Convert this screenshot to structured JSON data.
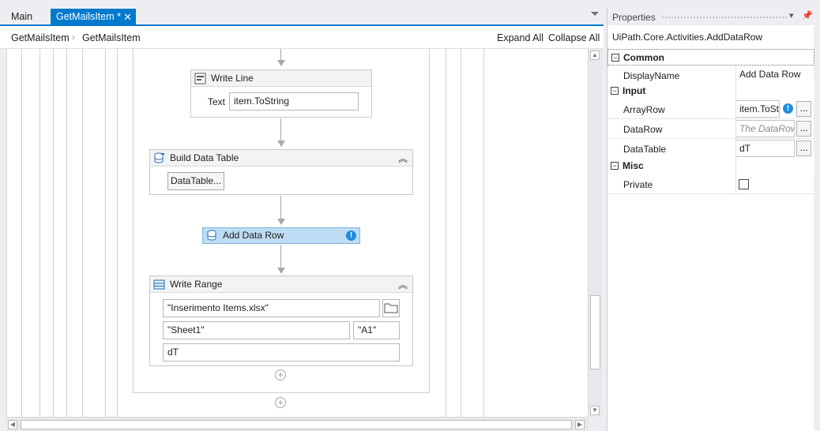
{
  "tabs": {
    "main_label": "Main",
    "active_label": "GetMailsItem *",
    "close_glyph": "✕"
  },
  "breadcrumb": {
    "items": [
      "GetMailsItem",
      "GetMailsItem"
    ],
    "expand_all": "Expand All",
    "collapse_all": "Collapse All"
  },
  "workflow": {
    "write_line": {
      "title": "Write Line",
      "text_label": "Text",
      "text_value": "item.ToString"
    },
    "build_data_table": {
      "title": "Build Data Table",
      "button_label": "DataTable..."
    },
    "add_data_row": {
      "title": "Add Data Row"
    },
    "write_range": {
      "title": "Write Range",
      "workbook": "\"Inserimento Items.xlsx\"",
      "sheet": "\"Sheet1\"",
      "cell": "\"A1\"",
      "datatable": "dT"
    }
  },
  "properties": {
    "title": "Properties",
    "type_name": "UiPath.Core.Activities.AddDataRow",
    "categories": {
      "common": "Common",
      "input": "Input",
      "misc": "Misc"
    },
    "rows": {
      "display_name_label": "DisplayName",
      "display_name_value": "Add Data Row",
      "array_row_label": "ArrayRow",
      "array_row_value": "item.ToSt",
      "data_row_label": "DataRow",
      "data_row_placeholder": "The DataRow",
      "data_table_label": "DataTable",
      "data_table_value": "dT",
      "private_label": "Private"
    },
    "ellipsis": "..."
  },
  "colors": {
    "accent": "#007acc",
    "selection": "#bedcf3",
    "info": "#1f8ee0"
  }
}
